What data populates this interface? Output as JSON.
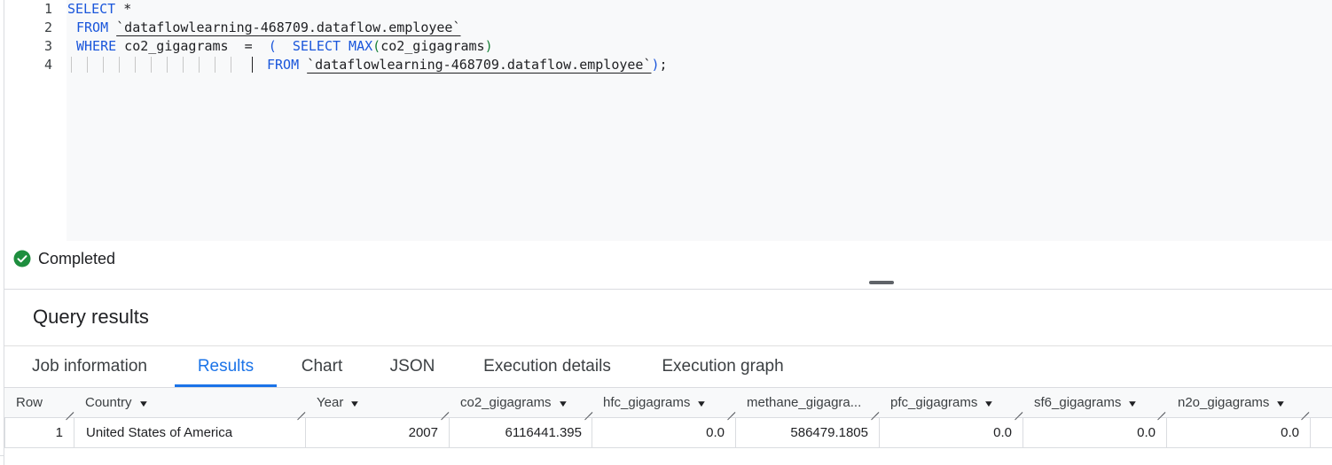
{
  "editor": {
    "line_numbers": [
      "1",
      "2",
      "3",
      "4"
    ],
    "lines": [
      {
        "kw1": "SELECT",
        "rest1": " *"
      },
      {
        "kw1": "FROM",
        "sp": " ",
        "tbl": "`dataflowlearning-468709.dataflow.employee`"
      },
      {
        "kw1": "WHERE",
        "mid": " co2_gigagrams  =  ",
        "paren_open": "(",
        "sp2": "  ",
        "kw2": "SELECT",
        "fn": " MAX",
        "paren_open2": "(",
        "col": "co2_gigagrams",
        "paren_close": ")"
      },
      {
        "kw1": "FROM",
        "sp": " ",
        "tbl": "`dataflowlearning-468709.dataflow.employee`",
        "paren_close": ")",
        "semi": ";"
      }
    ]
  },
  "status": {
    "text": "Completed",
    "icon": "check-circle-icon",
    "color": "#1e8e3e"
  },
  "results": {
    "title": "Query results"
  },
  "tabs": [
    {
      "label": "Job information",
      "active": false
    },
    {
      "label": "Results",
      "active": true
    },
    {
      "label": "Chart",
      "active": false
    },
    {
      "label": "JSON",
      "active": false
    },
    {
      "label": "Execution details",
      "active": false
    },
    {
      "label": "Execution graph",
      "active": false
    }
  ],
  "table": {
    "columns": [
      "Row",
      "Country",
      "Year",
      "co2_gigagrams",
      "hfc_gigagrams",
      "methane_gigagra...",
      "pfc_gigagrams",
      "sf6_gigagrams",
      "n2o_gigagrams"
    ],
    "rows": [
      [
        "1",
        "United States of America",
        "2007",
        "6116441.395",
        "0.0",
        "586479.1805",
        "0.0",
        "0.0",
        "0.0"
      ]
    ]
  },
  "colors": {
    "accent": "#1a73e8",
    "keyword": "#1a56db",
    "paren": "#188038"
  }
}
